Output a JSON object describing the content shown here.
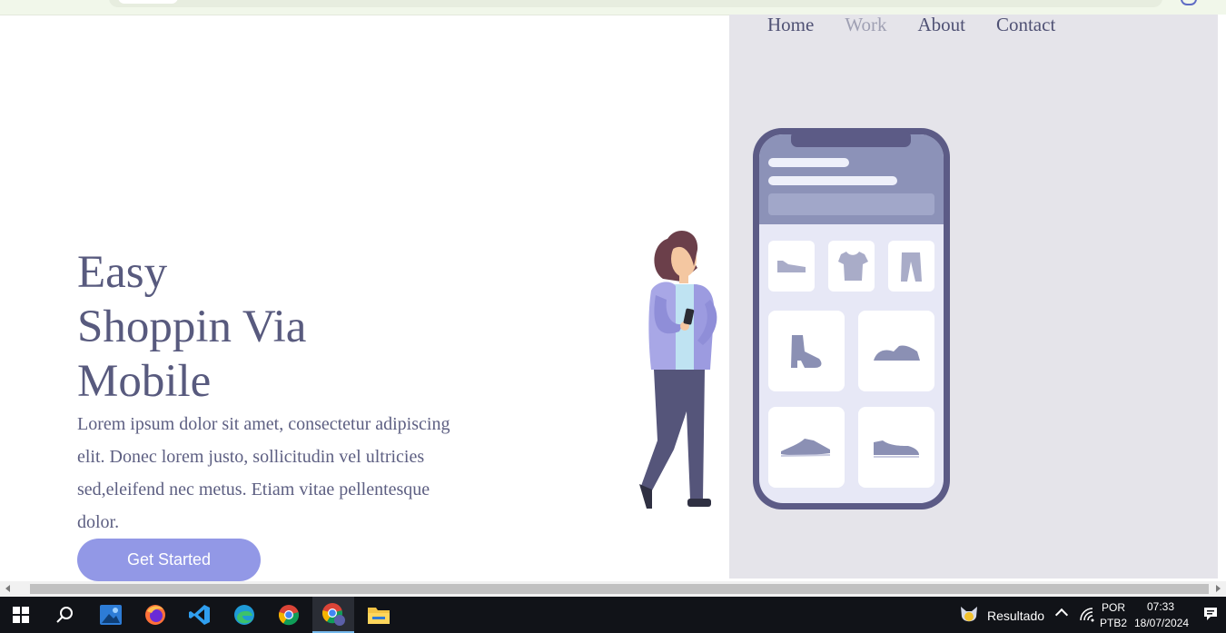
{
  "nav": {
    "items": [
      {
        "label": "Home",
        "active": false
      },
      {
        "label": "Work",
        "active": true
      },
      {
        "label": "About",
        "active": false
      },
      {
        "label": "Contact",
        "active": false
      }
    ]
  },
  "hero": {
    "title_lines": [
      "Easy",
      "Shoppin Via",
      "Mobile"
    ],
    "body": "Lorem ipsum dolor sit amet, consectetur adipiscing elit. Donec lorem justo, sollicitudin vel ultricies sed,eleifend nec metus. Etiam vitae pellentesque dolor.",
    "cta_label": "Get Started"
  },
  "colors": {
    "panel_bg": "#e5e4ea",
    "text_primary": "#585a7e",
    "cta_bg": "#9298e6",
    "phone_frame": "#5c5b86",
    "phone_header": "#8c92b8"
  },
  "taskbar": {
    "apps": [
      "windows-start-icon",
      "search-icon",
      "photos-icon",
      "firefox-icon",
      "vscode-icon",
      "edge-icon",
      "chrome-icon",
      "chrome-profile-icon",
      "file-explorer-icon"
    ],
    "active_app": "chrome-profile-icon",
    "notification_label": "Resultado",
    "language_top": "POR",
    "language_bottom": "PTB2",
    "time": "07:33",
    "date": "18/07/2024"
  }
}
